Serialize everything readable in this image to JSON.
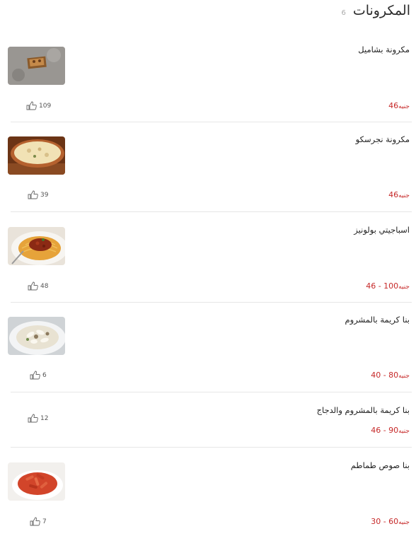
{
  "header": {
    "title": "المكرونات",
    "count": "6"
  },
  "currency": "جنيه",
  "items": [
    {
      "name": "مكرونة بشاميل",
      "price": "46",
      "likes": "109",
      "image": "bechamel-tray"
    },
    {
      "name": "مكرونة نجرسكو",
      "price": "46",
      "likes": "39",
      "image": "negresco-dish"
    },
    {
      "name": "اسباجيتي بولونيز",
      "price": "46 - 100",
      "likes": "48",
      "image": "spaghetti-bolognese"
    },
    {
      "name": "بنا كريمة بالمشروم",
      "price": "40 - 80",
      "likes": "6",
      "image": "penne-cream-mushroom"
    },
    {
      "name": "بنا كريمة بالمشروم والدجاج",
      "price": "46 - 90",
      "likes": "12",
      "image": ""
    },
    {
      "name": "بنا صوص طماطم",
      "price": "30 - 60",
      "likes": "7",
      "image": "penne-tomato"
    }
  ]
}
